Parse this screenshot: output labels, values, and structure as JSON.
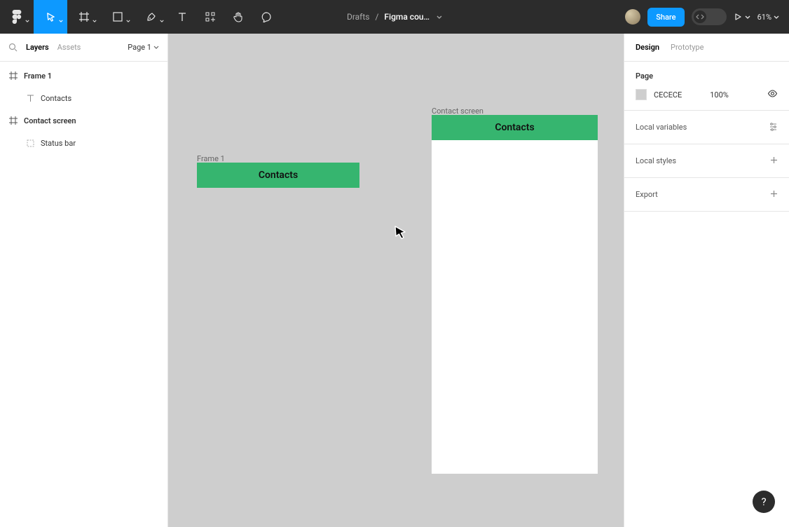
{
  "toolbar": {
    "project_folder": "Drafts",
    "file_name": "Figma cou…",
    "share_label": "Share",
    "zoom_label": "61%"
  },
  "left_panel": {
    "tabs": {
      "layers": "Layers",
      "assets": "Assets"
    },
    "page_label": "Page 1",
    "layers": [
      {
        "name": "Frame 1",
        "type": "frame"
      },
      {
        "name": "Contacts",
        "type": "text",
        "child": true
      },
      {
        "name": "Contact screen",
        "type": "frame"
      },
      {
        "name": "Status bar",
        "type": "group",
        "child": true
      }
    ]
  },
  "canvas": {
    "frame1": {
      "label": "Frame 1",
      "content": "Contacts"
    },
    "contact_screen": {
      "label": "Contact screen",
      "header": "Contacts"
    }
  },
  "right_panel": {
    "tabs": {
      "design": "Design",
      "prototype": "Prototype"
    },
    "page_section_title": "Page",
    "page_color_hex": "CECECE",
    "page_color_pct": "100%",
    "local_variables": "Local variables",
    "local_styles": "Local styles",
    "export": "Export"
  },
  "help": "?"
}
